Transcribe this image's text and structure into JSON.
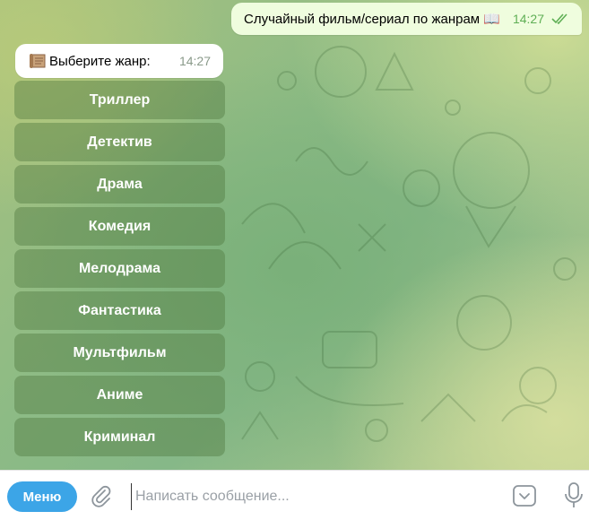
{
  "outgoing_message": {
    "text": "Случайный фильм/сериал по жанрам 📖",
    "time": "14:27",
    "status_icon": "double-check-icon"
  },
  "incoming_message": {
    "icon": "scroll-icon",
    "text": "Выберите жанр:",
    "time": "14:27"
  },
  "keyboard": {
    "buttons": [
      "Триллер",
      "Детектив",
      "Драма",
      "Комедия",
      "Мелодрама",
      "Фантастика",
      "Мультфильм",
      "Аниме",
      "Криминал"
    ]
  },
  "input_bar": {
    "menu_label": "Меню",
    "placeholder": "Написать сообщение...",
    "attach_icon": "paperclip-icon",
    "keyboard_icon": "keyboard-toggle-icon",
    "mic_icon": "microphone-icon"
  },
  "colors": {
    "menu_button": "#3ca5e7",
    "outgoing_bubble": "#effdde",
    "incoming_bubble": "#ffffff",
    "read_check": "#5faf55"
  }
}
